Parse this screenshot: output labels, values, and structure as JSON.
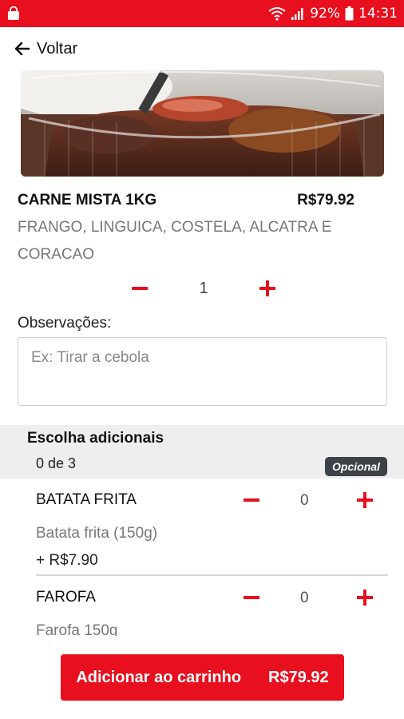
{
  "status_bar": {
    "battery": "92%",
    "time": "14:31",
    "icons": [
      "shopping-bag-icon",
      "wifi-icon",
      "signal-icon",
      "battery-icon"
    ]
  },
  "nav": {
    "back_label": "Voltar"
  },
  "product": {
    "name": "CARNE MISTA 1KG",
    "price": "R$79.92",
    "description": "FRANGO, LINGUICA, COSTELA, ALCATRA E CORACAO",
    "quantity": "1"
  },
  "notes": {
    "label": "Observações:",
    "placeholder": "Ex: Tirar a cebola"
  },
  "extras": {
    "title": "Escolha adicionais",
    "count": "0 de 3",
    "badge": "Opcional",
    "items": [
      {
        "name": "BATATA FRITA",
        "qty": "0",
        "description": "Batata frita (150g)",
        "price": "+ R$7.90"
      },
      {
        "name": "FAROFA",
        "qty": "0",
        "description": "Farofa 150g"
      }
    ]
  },
  "cart_button": {
    "label": "Adicionar ao carrinho",
    "total": "R$79.92"
  },
  "colors": {
    "accent": "#e8101f",
    "badge": "#3d4148",
    "section_bg": "#eeeeee"
  }
}
